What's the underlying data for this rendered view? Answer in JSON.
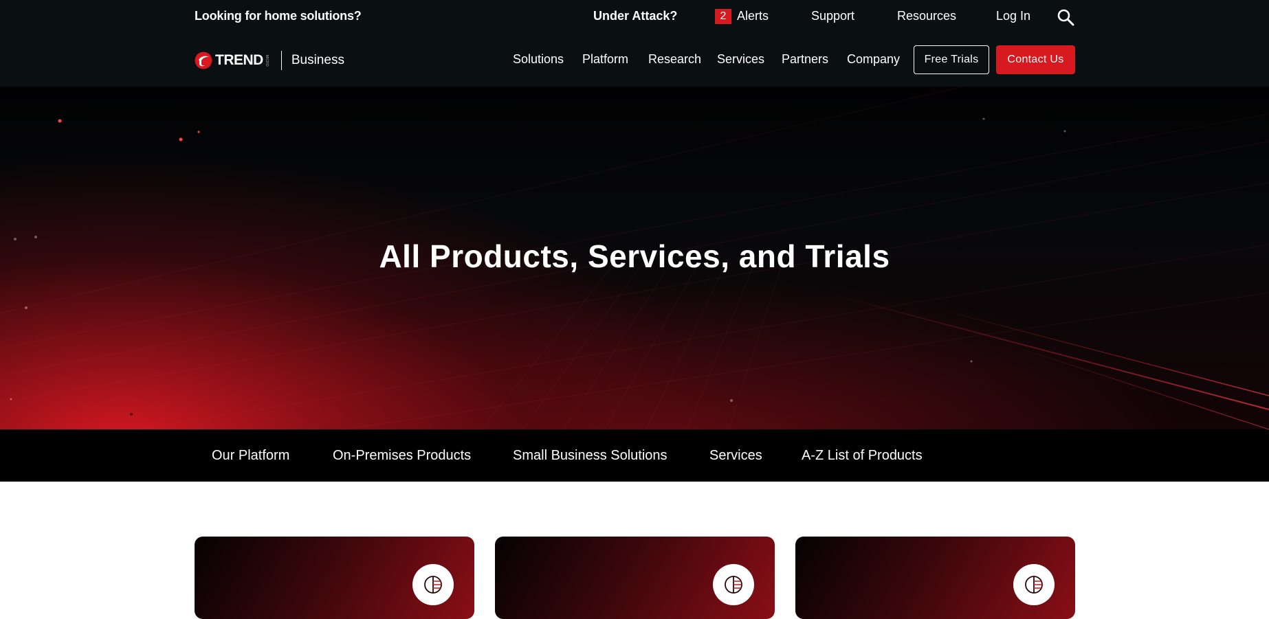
{
  "topbar": {
    "home_link": "Looking for home solutions?",
    "under_attack": "Under Attack?",
    "alerts_count": "2",
    "alerts_label": "Alerts",
    "support": "Support",
    "resources": "Resources",
    "login": "Log In",
    "search_icon": "search-icon"
  },
  "brand": {
    "logo_word": "TREND",
    "logo_micro": "MICRO",
    "division": "Business"
  },
  "nav": {
    "items": [
      "Solutions",
      "Platform",
      "Research",
      "Services",
      "Partners",
      "Company"
    ],
    "free_trials": "Free Trials",
    "contact_us": "Contact Us"
  },
  "hero": {
    "title": "All Products, Services, and Trials"
  },
  "subnav": {
    "items": [
      "Our Platform",
      "On-Premises Products",
      "Small Business Solutions",
      "Services",
      "A-Z List of Products"
    ]
  },
  "cards": [
    {
      "icon": "platform-icon"
    },
    {
      "icon": "platform-icon"
    },
    {
      "icon": "platform-icon"
    }
  ],
  "colors": {
    "brand_red": "#d71920",
    "nav_bg": "#0a0f12",
    "subnav_bg": "#000000"
  }
}
